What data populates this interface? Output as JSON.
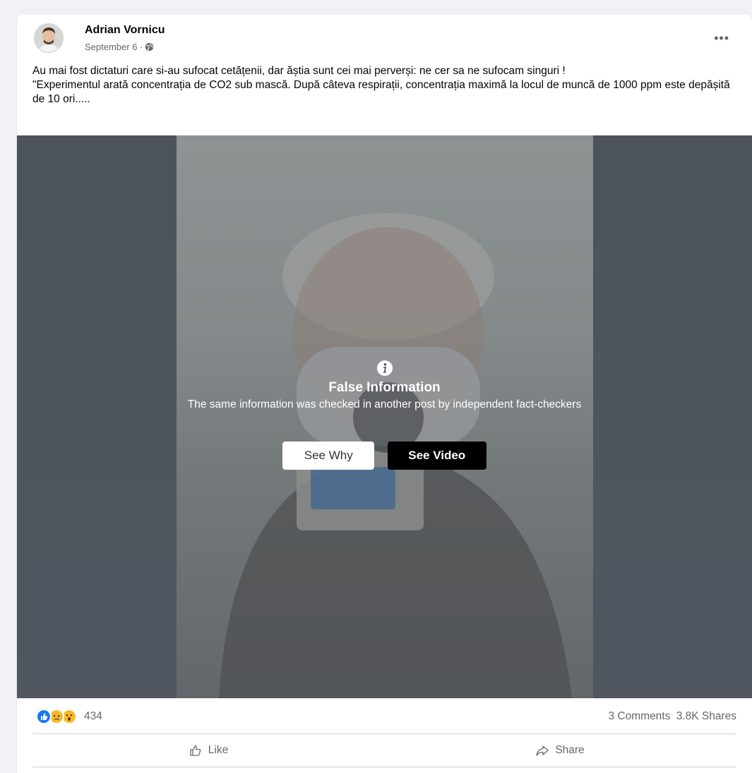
{
  "post": {
    "author": "Adrian Vornicu",
    "date": "September 6 ·",
    "more_label": "•••",
    "text_line1": "Au mai fost dictaturi care si-au sufocat cetățenii, dar ăștia sunt cei mai perverși: ne cer sa ne sufocam singuri !",
    "text_line2": "\"Experimentul arată concentrația de CO2 sub mască. După câteva respirații, concentrația maximă la locul de muncă de 1000 ppm este depășită de 10 ori....."
  },
  "warning": {
    "title": "False Information",
    "subtitle": "The same information was checked in another post by independent fact-checkers",
    "see_why_label": "See Why",
    "see_video_label": "See Video"
  },
  "stats": {
    "reaction_icons": [
      "like-icon",
      "sad-icon",
      "wow-icon"
    ],
    "reaction_count": "434",
    "comments": "3 Comments",
    "shares": "3.8K Shares"
  },
  "actions": {
    "like_label": "Like",
    "share_label": "Share"
  },
  "colors": {
    "like_blue": "#1877f2",
    "reaction_yellow": "#f7b928",
    "text_secondary": "#65676b"
  }
}
